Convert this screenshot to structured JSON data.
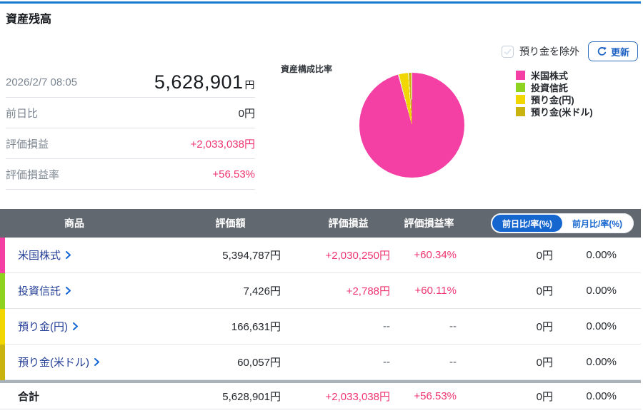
{
  "page": {
    "title": "資産残高"
  },
  "controls": {
    "exclude_checkbox_label": "預り金を除外",
    "exclude_checkbox_checked": false,
    "refresh_label": "更新"
  },
  "summary": {
    "timestamp": "2026/2/7 08:05",
    "total_value": "5,628,901",
    "yen_suffix": "円",
    "rows": [
      {
        "label": "前日比",
        "value": "0円"
      },
      {
        "label": "評価損益",
        "value": "+2,033,038円"
      },
      {
        "label": "評価損益率",
        "value": "+56.53%"
      }
    ]
  },
  "chart_data": {
    "type": "pie",
    "title": "資産構成比率",
    "labels": [
      "米国株式",
      "投資信託",
      "預り金(円)",
      "預り金(米ドル)"
    ],
    "values_yen": [
      5394787,
      7426,
      166631,
      60057
    ],
    "values_percent": [
      95.84,
      0.13,
      2.96,
      1.07
    ],
    "colors": [
      "#f43fa5",
      "#8fd321",
      "#f2d600",
      "#c9b30e"
    ],
    "legend_position": "right",
    "start_angle_deg": 0,
    "direction": "clockwise"
  },
  "table": {
    "headers": [
      "商品",
      "評価額",
      "評価損益",
      "評価損益率"
    ],
    "toggle": {
      "selected": "前日比/率(%)",
      "unselected": "前月比/率(%)"
    },
    "rows": [
      {
        "name": "米国株式",
        "bar_color": "#f43fa5",
        "valuation": "5,394,787円",
        "pl": "+2,030,250円",
        "pl_pct": "+60.34%",
        "day_change": "0円",
        "day_pct": "0.00%"
      },
      {
        "name": "投資信託",
        "bar_color": "#8fd321",
        "valuation": "7,426円",
        "pl": "+2,788円",
        "pl_pct": "+60.11%",
        "day_change": "0円",
        "day_pct": "0.00%"
      },
      {
        "name": "預り金(円)",
        "bar_color": "#f2d600",
        "valuation": "166,631円",
        "pl": "--",
        "pl_pct": "--",
        "day_change": "0円",
        "day_pct": "0.00%"
      },
      {
        "name": "預り金(米ドル)",
        "bar_color": "#c9b30e",
        "valuation": "60,057円",
        "pl": "--",
        "pl_pct": "--",
        "day_change": "0円",
        "day_pct": "0.00%"
      }
    ],
    "total": {
      "label": "合計",
      "valuation": "5,628,901円",
      "pl": "+2,033,038円",
      "pl_pct": "+56.53%",
      "day_change": "0円",
      "day_pct": "0.00%"
    }
  },
  "colors": {
    "accent_blue": "#1566cf",
    "top_line_blue": "#1779d0",
    "pink_text": "#ee3470",
    "link_blue": "#233e96",
    "table_header_bg": "#62686f"
  }
}
